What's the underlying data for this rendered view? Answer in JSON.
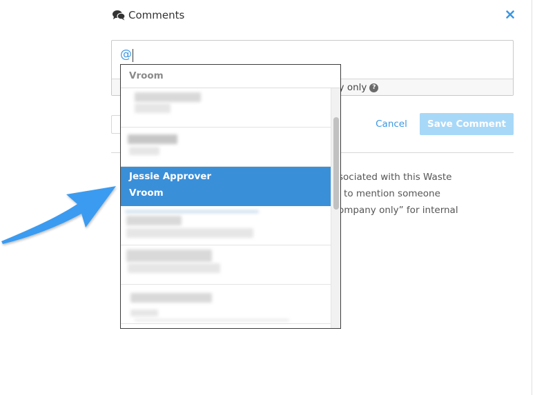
{
  "panel": {
    "title": "Comments",
    "title_icon": "comments-icon",
    "close_icon": "close-icon",
    "colors": {
      "accent": "#3b97e3",
      "selected": "#3a8fd9",
      "save_disabled": "#a8d8f8",
      "arrow": "#3a9bf0"
    }
  },
  "comment_box": {
    "value": "@",
    "footer_text": "ny only",
    "help_icon": "question-circle-icon"
  },
  "actions": {
    "cancel_label": "Cancel",
    "save_label": "Save Comment"
  },
  "info_text": {
    "line1": "sociated with this Waste",
    "line2": "l to mention someone",
    "line3": "ompany only” for internal"
  },
  "mention_dropdown": {
    "group_header": "Vroom",
    "selected_item": {
      "name": "Jessie Approver",
      "company": "Vroom"
    },
    "blurred_items_count_note": "",
    "annotation": "arrow-pointer-icon"
  }
}
